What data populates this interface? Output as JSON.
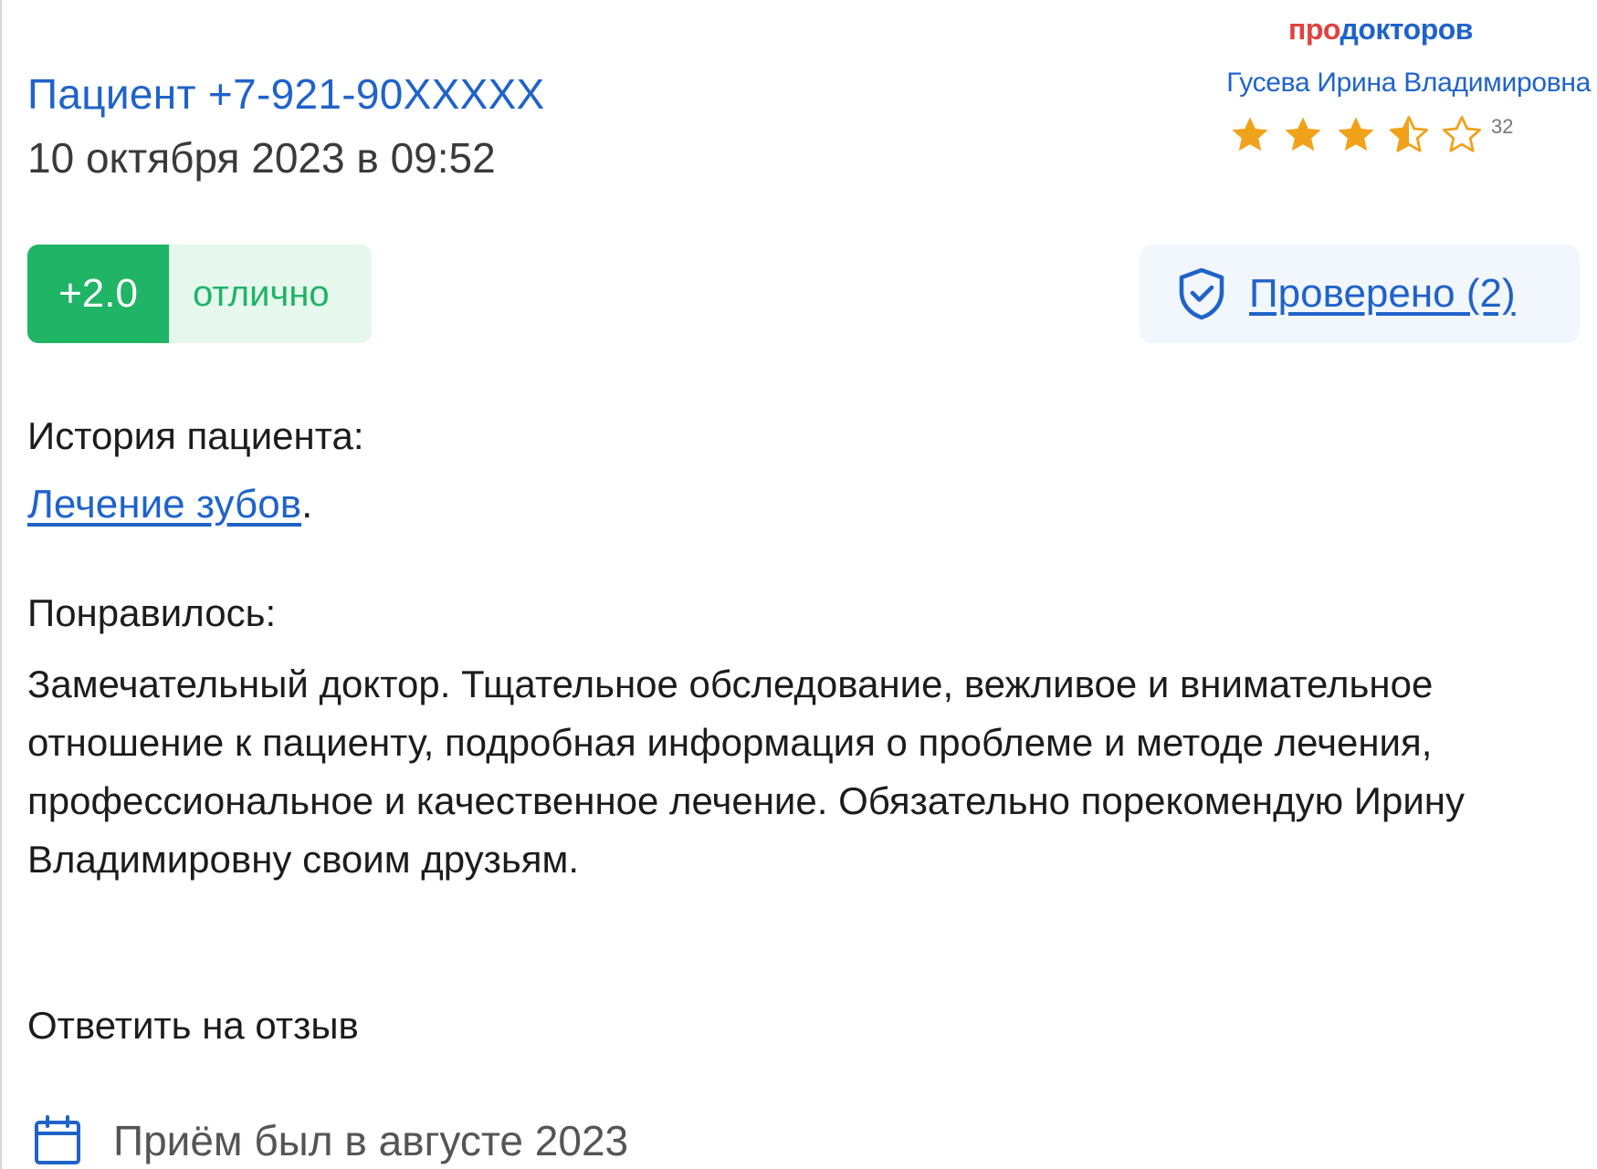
{
  "header": {
    "logo_pro": "про",
    "logo_doctors": "докторов",
    "doctor_name": "Гусева Ирина Владимировна",
    "doctor_rating_stars": 3.5,
    "doctor_rating_max": 5,
    "doctor_reviews_count": "32"
  },
  "review": {
    "author": "Пациент +7-921-90XXXXX",
    "date": "10 октября 2023 в 09:52",
    "score": "+2.0",
    "score_label": "отлично",
    "verified_label": "Проверено (2)",
    "history_title": "История пациента:",
    "history_link": "Лечение зубов",
    "history_link_suffix": ".",
    "liked_title": "Понравилось:",
    "liked_text": "Замечательный доктор. Тщательное обследование, вежливое и внимательное отношение к пациенту, подробная информация о проблеме и методе лечения, профессиональное и качественное лечение. Обязательно порекомендую Ирину Владимировну своим друзьям.",
    "reply_label": "Ответить на отзыв",
    "visit_text": "Приём был в августе 2023"
  },
  "icons": {
    "star": "star-icon",
    "shield": "shield-check-icon",
    "calendar": "calendar-icon"
  },
  "colors": {
    "brand_blue": "#1f63c9",
    "brand_red": "#e2403e",
    "star_gold": "#f0a21a",
    "score_green": "#1fb466",
    "score_bg": "#e6f7ee",
    "verified_bg": "#f2f6fd"
  }
}
